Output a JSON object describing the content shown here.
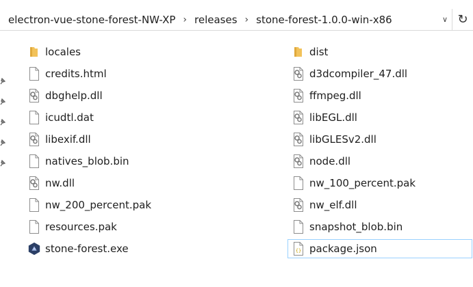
{
  "address": {
    "crumbs": [
      "electron-vue-stone-forest-NW-XP",
      "releases",
      "stone-forest-1.0.0-win-x86"
    ],
    "separator": "›",
    "dropdown_glyph": "∨",
    "refresh_glyph": "↻"
  },
  "files": [
    {
      "name": "locales",
      "icon": "folder-icon"
    },
    {
      "name": "dist",
      "icon": "folder-icon"
    },
    {
      "name": "credits.html",
      "icon": "document-icon"
    },
    {
      "name": "d3dcompiler_47.dll",
      "icon": "dll-gear-icon"
    },
    {
      "name": "dbghelp.dll",
      "icon": "dll-gear-icon"
    },
    {
      "name": "ffmpeg.dll",
      "icon": "dll-gear-icon"
    },
    {
      "name": "icudtl.dat",
      "icon": "document-icon"
    },
    {
      "name": "libEGL.dll",
      "icon": "dll-gear-icon"
    },
    {
      "name": "libexif.dll",
      "icon": "dll-gear-icon"
    },
    {
      "name": "libGLESv2.dll",
      "icon": "dll-gear-icon"
    },
    {
      "name": "natives_blob.bin",
      "icon": "document-icon"
    },
    {
      "name": "node.dll",
      "icon": "dll-gear-icon"
    },
    {
      "name": "nw.dll",
      "icon": "dll-gear-icon"
    },
    {
      "name": "nw_100_percent.pak",
      "icon": "document-icon"
    },
    {
      "name": "nw_200_percent.pak",
      "icon": "document-icon"
    },
    {
      "name": "nw_elf.dll",
      "icon": "dll-gear-icon"
    },
    {
      "name": "resources.pak",
      "icon": "document-icon"
    },
    {
      "name": "snapshot_blob.bin",
      "icon": "document-icon"
    },
    {
      "name": "stone-forest.exe",
      "icon": "exe-app-icon"
    },
    {
      "name": "package.json",
      "icon": "json-file-icon",
      "focused": true
    }
  ],
  "colors": {
    "folder": "#f2c25a",
    "focus_border": "#99d1ff",
    "exe_bg": "#2b3f66"
  }
}
